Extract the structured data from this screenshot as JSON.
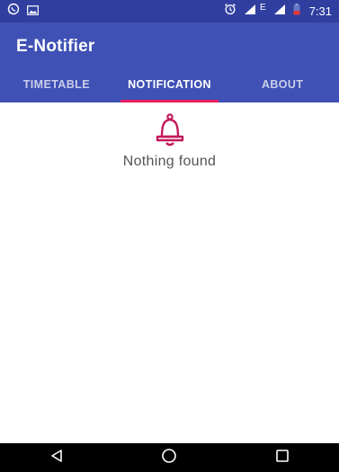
{
  "status_bar": {
    "time": "7:31",
    "network_label": "E",
    "icons": [
      "whatsapp-icon",
      "image-icon",
      "alarm-icon",
      "signal-icon",
      "battery-icon"
    ]
  },
  "app_bar": {
    "title": "E-Notifier"
  },
  "tabs": [
    {
      "label": "TIMETABLE",
      "active": false
    },
    {
      "label": "NOTIFICATION",
      "active": true
    },
    {
      "label": "ABOUT",
      "active": false
    }
  ],
  "empty_state": {
    "icon": "bell-icon",
    "message": "Nothing found"
  },
  "nav_bar": {
    "icons": [
      "back-icon",
      "home-icon",
      "recents-icon"
    ]
  },
  "colors": {
    "status_bar": "#303f9f",
    "app_bar": "#3f51b5",
    "tab_indicator": "#e91e63",
    "bell": "#c2185b"
  }
}
